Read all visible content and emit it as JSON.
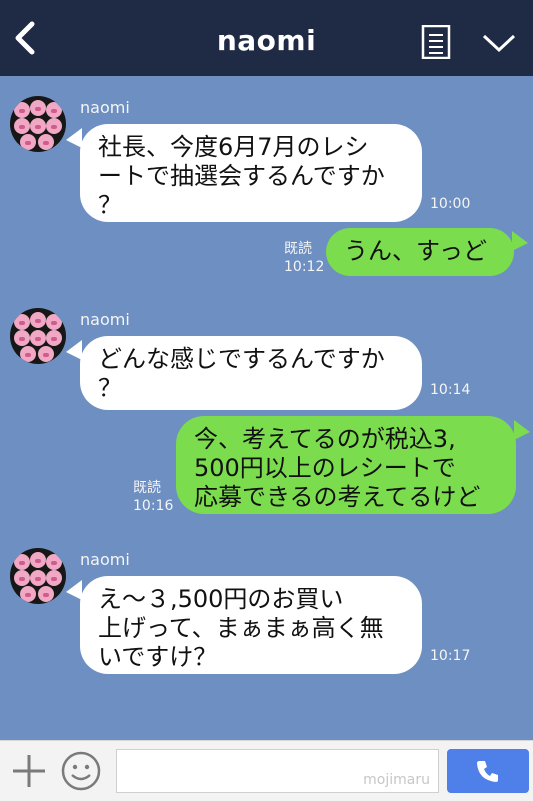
{
  "header": {
    "title": "naomi",
    "back_icon": "chevron-left-icon",
    "menu_icon": "list-icon",
    "collapse_icon": "chevron-down-icon"
  },
  "messages": [
    {
      "sender": "naomi",
      "text": "社長、今度6月7月のレシ\nートで抽選会するんですか\n？",
      "time": "10:00"
    },
    {
      "status": "既読",
      "text": "うん、すっど",
      "time": "10:12"
    },
    {
      "sender": "naomi",
      "text": "どんな感じでするんですか\n？",
      "time": "10:14"
    },
    {
      "status": "既読",
      "text": "今、考えてるのが税込3,\n500円以上のレシートで\n応募できるの考えてるけど",
      "time": "10:16"
    },
    {
      "sender": "naomi",
      "text": "え〜３,500円のお買い\n上げって、まぁまぁ高く無\nいですけ？",
      "time": "10:17"
    }
  ],
  "composer": {
    "plus_icon": "plus-icon",
    "emoji_icon": "smiley-icon",
    "watermark": "mojimaru",
    "send_icon": "phone-icon"
  },
  "colors": {
    "header_bg": "#1f2a44",
    "chat_bg": "#6e8fc1",
    "incoming_bubble": "#ffffff",
    "outgoing_bubble": "#7bdc4d",
    "send_button": "#4f7fe8"
  }
}
